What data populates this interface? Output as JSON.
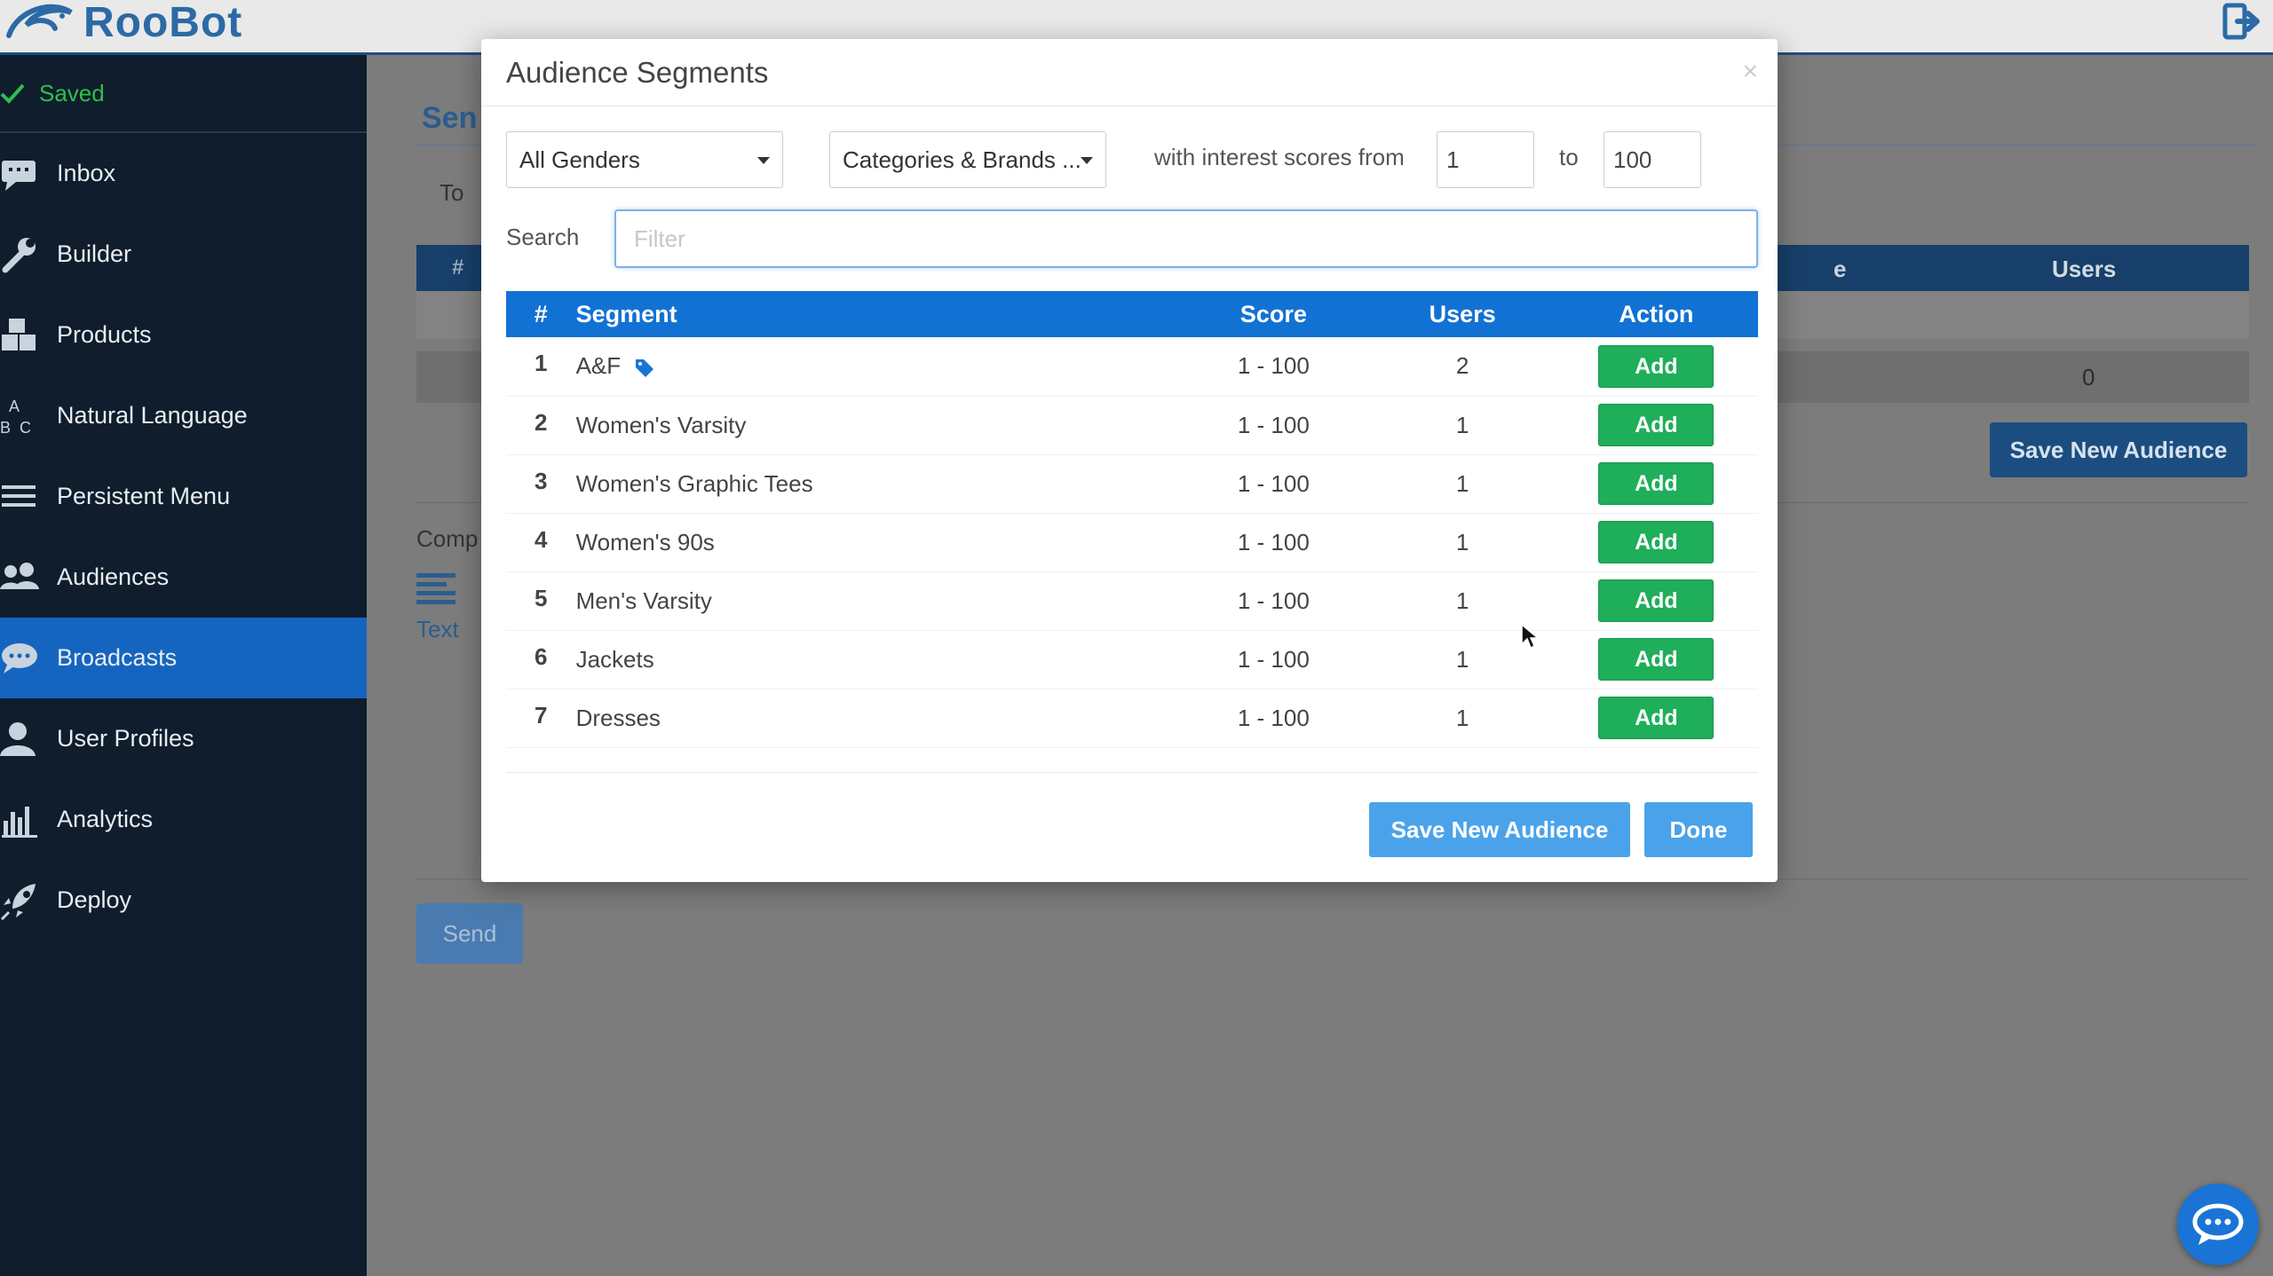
{
  "app": {
    "name": "RooBot"
  },
  "sidebar": {
    "status": "Saved",
    "items": [
      {
        "label": "Inbox",
        "icon": "inbox-icon",
        "active": false
      },
      {
        "label": "Builder",
        "icon": "wrench-icon",
        "active": false
      },
      {
        "label": "Products",
        "icon": "boxes-icon",
        "active": false
      },
      {
        "label": "Natural Language",
        "icon": "abc-icon",
        "active": false
      },
      {
        "label": "Persistent Menu",
        "icon": "menu-icon",
        "active": false
      },
      {
        "label": "Audiences",
        "icon": "users-icon",
        "active": false
      },
      {
        "label": "Broadcasts",
        "icon": "chat-icon",
        "active": true
      },
      {
        "label": "User Profiles",
        "icon": "user-icon",
        "active": false
      },
      {
        "label": "Analytics",
        "icon": "bar-chart-icon",
        "active": false
      },
      {
        "label": "Deploy",
        "icon": "rocket-icon",
        "active": false
      }
    ]
  },
  "background": {
    "title": "Sen",
    "to_label": "To",
    "hash": "#",
    "re_label": "e",
    "users_header": "Users",
    "users_value": "0",
    "save_button": "Save New Audience",
    "compose_label": "Comp",
    "text_label": "Text",
    "send_button": "Send"
  },
  "modal": {
    "title": "Audience Segments",
    "close": "×",
    "gender_select": "All Genders",
    "category_select": "Categories & Brands ...",
    "interest_text": "with interest scores from",
    "score_from": "1",
    "to_text": "to",
    "score_to": "100",
    "search_label": "Search",
    "search_placeholder": "Filter",
    "table": {
      "headers": {
        "num": "#",
        "segment": "Segment",
        "score": "Score",
        "users": "Users",
        "action": "Action"
      },
      "rows": [
        {
          "num": "1",
          "segment": "A&F",
          "score": "1 - 100",
          "users": "2",
          "action": "Add",
          "tag": true
        },
        {
          "num": "2",
          "segment": "Women's Varsity",
          "score": "1 - 100",
          "users": "1",
          "action": "Add",
          "tag": false
        },
        {
          "num": "3",
          "segment": "Women's Graphic Tees",
          "score": "1 - 100",
          "users": "1",
          "action": "Add",
          "tag": false
        },
        {
          "num": "4",
          "segment": "Women's 90s",
          "score": "1 - 100",
          "users": "1",
          "action": "Add",
          "tag": false
        },
        {
          "num": "5",
          "segment": "Men's Varsity",
          "score": "1 - 100",
          "users": "1",
          "action": "Add",
          "tag": false
        },
        {
          "num": "6",
          "segment": "Jackets",
          "score": "1 - 100",
          "users": "1",
          "action": "Add",
          "tag": false
        },
        {
          "num": "7",
          "segment": "Dresses",
          "score": "1 - 100",
          "users": "1",
          "action": "Add",
          "tag": false
        }
      ]
    },
    "save_button": "Save New Audience",
    "done_button": "Done"
  },
  "colors": {
    "sidebar_bg": "#0f1d2c",
    "active_nav": "#1565c0",
    "table_header": "#1272d4",
    "add_button": "#1fae5a",
    "modal_button": "#4aa3ea",
    "saved_green": "#2fbf4d"
  }
}
